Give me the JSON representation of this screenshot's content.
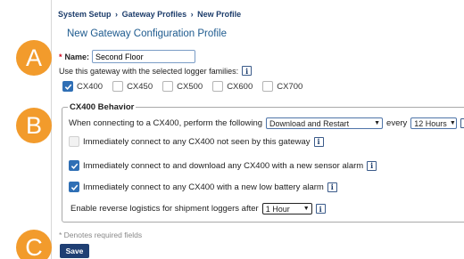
{
  "breadcrumb": {
    "items": [
      "System Setup",
      "Gateway Profiles",
      "New Profile"
    ],
    "separator": "›"
  },
  "page_title": "New Gateway Configuration Profile",
  "name_field": {
    "required_mark": "*",
    "label": "Name:",
    "value": "Second Floor"
  },
  "logger_families": {
    "question": "Use this gateway with the selected logger families:",
    "options": [
      {
        "label": "CX400",
        "checked": true
      },
      {
        "label": "CX450",
        "checked": false
      },
      {
        "label": "CX500",
        "checked": false
      },
      {
        "label": "CX600",
        "checked": false
      },
      {
        "label": "CX700",
        "checked": false
      }
    ]
  },
  "behavior": {
    "legend": "CX400 Behavior",
    "connect_prefix": "When connecting to a CX400, perform the following",
    "action_select": "Download and Restart",
    "every_label": "every",
    "interval_select": "12 Hours",
    "opt_not_seen": {
      "label": "Immediately connect to any CX400 not seen by this gateway",
      "checked": false
    },
    "opt_sensor_alarm": {
      "label": "Immediately connect to and download any CX400 with a new sensor alarm",
      "checked": true
    },
    "opt_low_battery": {
      "label": "Immediately connect to any CX400 with a new low battery alarm",
      "checked": true
    },
    "reverse_logistics_label": "Enable reverse logistics for shipment loggers after",
    "reverse_logistics_select": "1 Hour"
  },
  "required_note": "* Denotes required fields",
  "save_label": "Save",
  "markers": [
    "A",
    "B",
    "C"
  ],
  "info_icon_glyph": "i",
  "colors": {
    "accent": "#1f3f73",
    "marker": "#f29b2c",
    "checkbox": "#2f6fb5"
  }
}
